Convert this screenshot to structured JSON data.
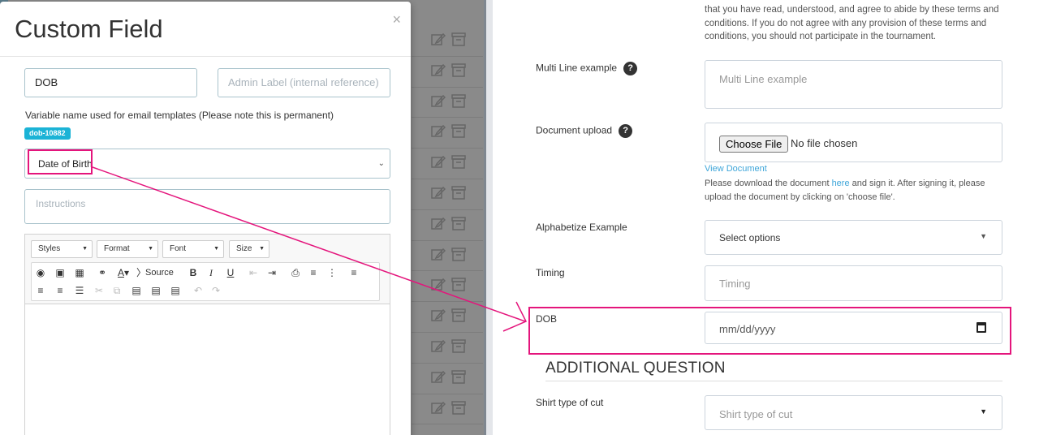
{
  "modal": {
    "title": "Custom Field",
    "close_glyph": "×",
    "label_input_value": "DOB",
    "admin_label_placeholder": "Admin Label (internal reference)",
    "variable_note": "Variable name used for email templates (Please note this is permanent)",
    "variable_badge": "dob-10882",
    "field_type_selected": "Date of Birth",
    "instructions_placeholder": "Instructions",
    "editor": {
      "combos": [
        "Styles",
        "Format",
        "Font",
        "Size"
      ],
      "source_label": "Source"
    }
  },
  "form": {
    "terms_lines": [
      "that you have read, understood, and agree to abide by these terms and",
      "conditions. If you do not agree with any provision of these terms and",
      "conditions, you should not participate in the tournament."
    ],
    "multiline_label": "Multi Line example",
    "multiline_placeholder": "Multi Line example",
    "doc_upload_label": "Document upload",
    "choose_file": "Choose File",
    "no_file": "No file chosen",
    "view_document": "View Document",
    "doc_note_1a": "Please download the document ",
    "doc_note_link": "here",
    "doc_note_1b": " and sign it. After signing it, please",
    "doc_note_2": "upload the document by clicking on 'choose file'.",
    "alphabetize_label": "Alphabetize Example",
    "alphabetize_value": "Select options",
    "timing_label": "Timing",
    "timing_placeholder": "Timing",
    "dob_label": "DOB",
    "dob_placeholder": "mm/dd/yyyy",
    "section_title": "ADDITIONAL QUESTION",
    "shirt_label": "Shirt type of cut",
    "shirt_placeholder": "Shirt type of cut",
    "help_glyph": "?"
  },
  "colors": {
    "highlight": "#e4157c",
    "badge": "#1bb3d6",
    "link": "#3da5d9"
  }
}
